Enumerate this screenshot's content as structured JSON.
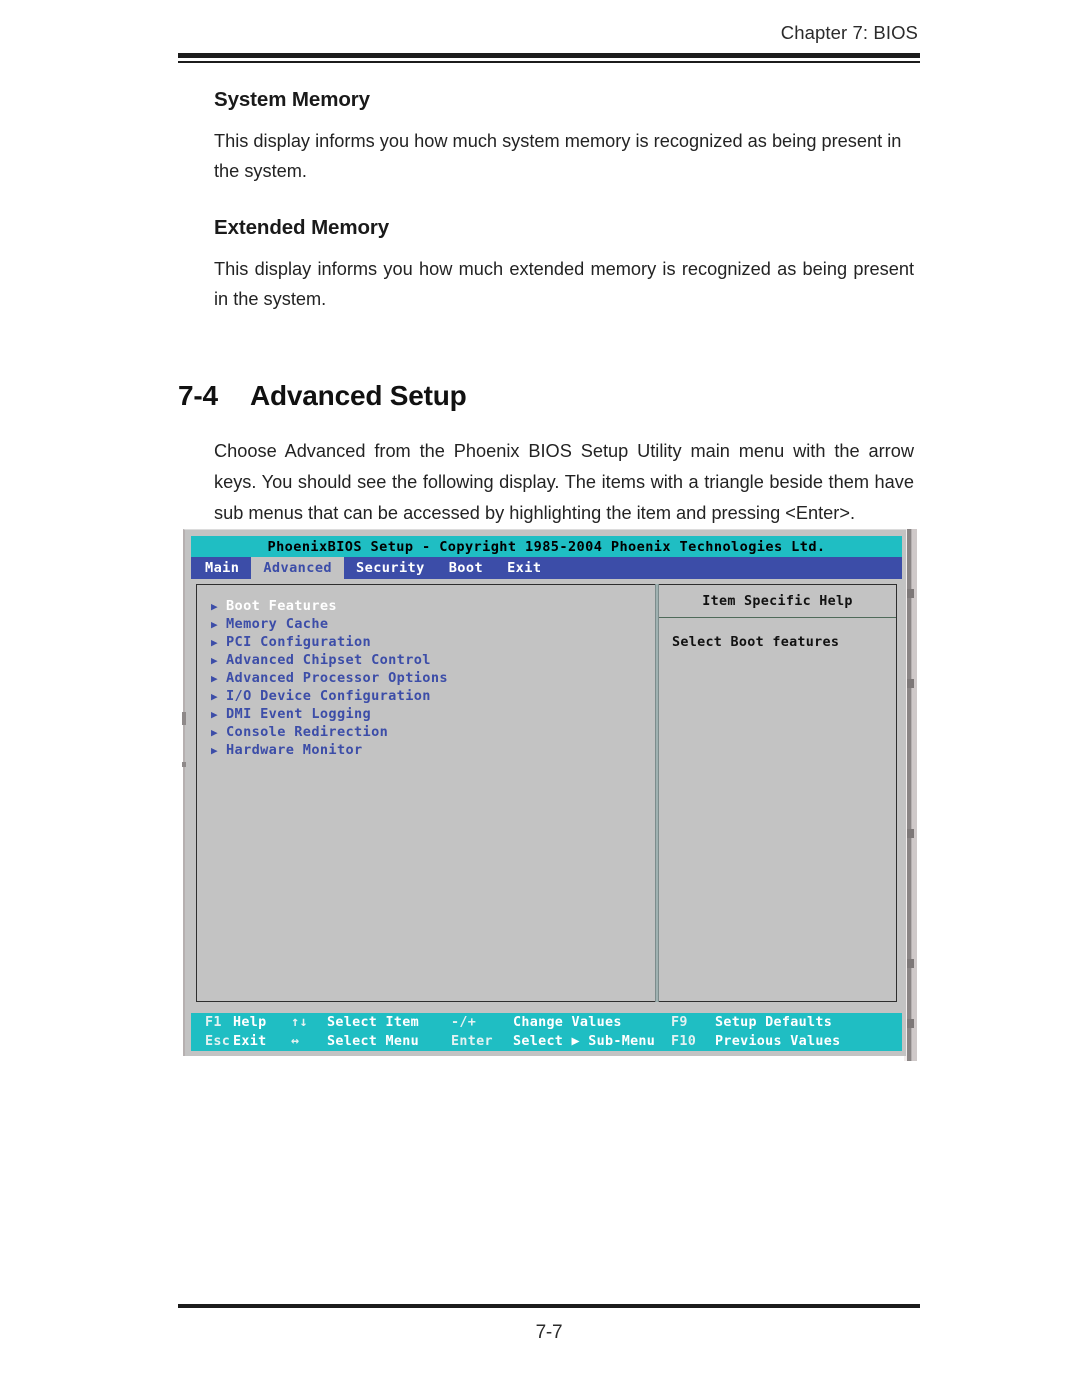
{
  "page": {
    "running_head": "Chapter 7: BIOS",
    "page_number": "7-7"
  },
  "sections": [
    {
      "heading": "System Memory",
      "paragraph": "This display informs you how much system memory is recognized as being present in the system."
    },
    {
      "heading": "Extended Memory",
      "paragraph": "This display informs you how much extended memory is recognized as being present in the system."
    }
  ],
  "section_title": {
    "number": "7-4",
    "name": "Advanced Setup"
  },
  "intro_paragraph": "Choose Advanced from the Phoenix BIOS Setup Utility main menu with the arrow keys. You should see the following display.  The items with a triangle beside them have sub menus that can be accessed by highlighting the item and pressing <Enter>.",
  "bios": {
    "title_bar": "PhoenixBIOS Setup - Copyright 1985-2004 Phoenix Technologies Ltd.",
    "tabs": [
      {
        "label": "Main",
        "active": false
      },
      {
        "label": "Advanced",
        "active": true
      },
      {
        "label": "Security",
        "active": false
      },
      {
        "label": "Boot",
        "active": false
      },
      {
        "label": "Exit",
        "active": false
      }
    ],
    "submenu_marker": "▶",
    "menu_items": [
      {
        "label": "Boot Features",
        "selected": true
      },
      {
        "label": "Memory Cache",
        "selected": false
      },
      {
        "label": "PCI Configuration",
        "selected": false
      },
      {
        "label": "Advanced Chipset Control",
        "selected": false
      },
      {
        "label": "Advanced Processor Options",
        "selected": false
      },
      {
        "label": "I/O Device Configuration",
        "selected": false
      },
      {
        "label": "DMI Event Logging",
        "selected": false
      },
      {
        "label": "Console Redirection",
        "selected": false
      },
      {
        "label": "Hardware Monitor",
        "selected": false
      }
    ],
    "help": {
      "title": "Item Specific Help",
      "text": "Select Boot features"
    },
    "footer": {
      "row1": [
        {
          "key": "F1",
          "label": "Help"
        },
        {
          "key": "↑↓",
          "label": "Select Item"
        },
        {
          "key": "-/+",
          "label": "Change Values"
        },
        {
          "key": "F9",
          "label": "Setup Defaults"
        }
      ],
      "row2": [
        {
          "key": "Esc",
          "label": "Exit"
        },
        {
          "key": "↔",
          "label": "Select Menu"
        },
        {
          "key": "Enter",
          "label": "Select ▶ Sub-Menu"
        },
        {
          "key": "F10",
          "label": "Previous Values"
        }
      ]
    },
    "colors": {
      "title_bar": "#1fbec3",
      "menu_bar": "#3c4da8",
      "screen_bg": "#c3c3c3",
      "menu_text": "#3c4da8",
      "selected_text": "#ffffff",
      "footer_bar": "#1fbec3"
    }
  }
}
